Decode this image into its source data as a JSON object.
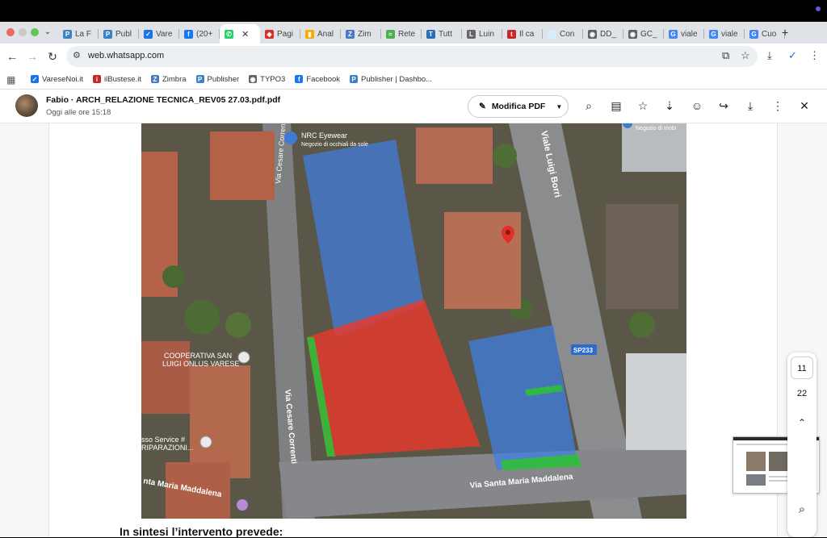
{
  "browser": {
    "tabs": [
      {
        "label": "La F",
        "icon": "p-icon",
        "color": "#3b82c4"
      },
      {
        "label": "Publ",
        "icon": "p-icon",
        "color": "#3b82c4"
      },
      {
        "label": "Vare",
        "icon": "check-icon",
        "color": "#1a73e8"
      },
      {
        "label": "(20+",
        "icon": "facebook-icon",
        "color": "#1877f2"
      },
      {
        "label": "",
        "icon": "whatsapp-icon",
        "color": "#25d366",
        "active": true
      },
      {
        "label": "Pagi",
        "icon": "shield-icon",
        "color": "#d93025"
      },
      {
        "label": "Anal",
        "icon": "analytics-icon",
        "color": "#f9ab00"
      },
      {
        "label": "Zim",
        "icon": "zimbra-icon",
        "color": "#4a78c2"
      },
      {
        "label": "Rete",
        "icon": "rete-icon",
        "color": "#4caf50"
      },
      {
        "label": "Tutt",
        "icon": "tutt-icon",
        "color": "#2c6fb7"
      },
      {
        "label": "Luin",
        "icon": "l-icon",
        "color": "#666666"
      },
      {
        "label": "Il ca",
        "icon": "tio-icon",
        "color": "#c62828"
      },
      {
        "label": "Con",
        "icon": "blank-icon",
        "color": "#d6eefc"
      },
      {
        "label": "DD_",
        "icon": "globe-icon",
        "color": "#5f6368"
      },
      {
        "label": "GC_",
        "icon": "globe-icon",
        "color": "#5f6368"
      },
      {
        "label": "viale",
        "icon": "google-icon",
        "color": "#4285f4"
      },
      {
        "label": "viale",
        "icon": "google-icon",
        "color": "#4285f4"
      },
      {
        "label": "Cuo",
        "icon": "google-icon",
        "color": "#4285f4"
      }
    ],
    "tab_close": "✕",
    "new_tab": "+",
    "url": "web.whatsapp.com",
    "bookmarks": [
      {
        "label": "VareseNoi.it",
        "icon": "check-icon",
        "color": "#1a73e8"
      },
      {
        "label": "ilBustese.it",
        "icon": "ib-icon",
        "color": "#c62828"
      },
      {
        "label": "Zimbra",
        "icon": "zimbra-icon",
        "color": "#4a78c2"
      },
      {
        "label": "Publisher",
        "icon": "p-icon",
        "color": "#3b82c4"
      },
      {
        "label": "TYPO3",
        "icon": "globe-icon",
        "color": "#5f6368"
      },
      {
        "label": "Facebook",
        "icon": "facebook-icon",
        "color": "#1877f2"
      },
      {
        "label": "Publisher | Dashbo...",
        "icon": "p-icon",
        "color": "#3b82c4"
      }
    ]
  },
  "viewer": {
    "file_name": "Fabio · ARCH_RELAZIONE TECNICA_REV05 27.03.pdf.pdf",
    "file_meta": "Oggi alle ore 15:18",
    "edit_button": "Modifica PDF",
    "page_current": "11",
    "page_total": "22",
    "body_text": "In sintesi l’intervento prevede:"
  },
  "map": {
    "labels": {
      "nrc": "NRC Eyewear",
      "nrc_sub": "Negozio di occhiali da sole",
      "viale": "Viale Luigi Borri",
      "cesare_top": "Via Cesare Correnti",
      "cesare_mid": "Via Cesare Correnti",
      "cooperativa1": "COOPERATIVA SAN",
      "cooperativa2": "LUIGI ONLUS VARESE",
      "sp": "SP233",
      "service1": "sso Service #",
      "service2": "RIPARAZIONI...",
      "smm_right": "Via Santa Maria Maddalena",
      "smm_left": "nta Maria Maddalena",
      "negozio": "Negozio di mobi"
    },
    "colors": {
      "blue_zone": "#3f7fe6",
      "red_zone": "#e8392b",
      "green_strip": "#2fbf3a"
    }
  }
}
